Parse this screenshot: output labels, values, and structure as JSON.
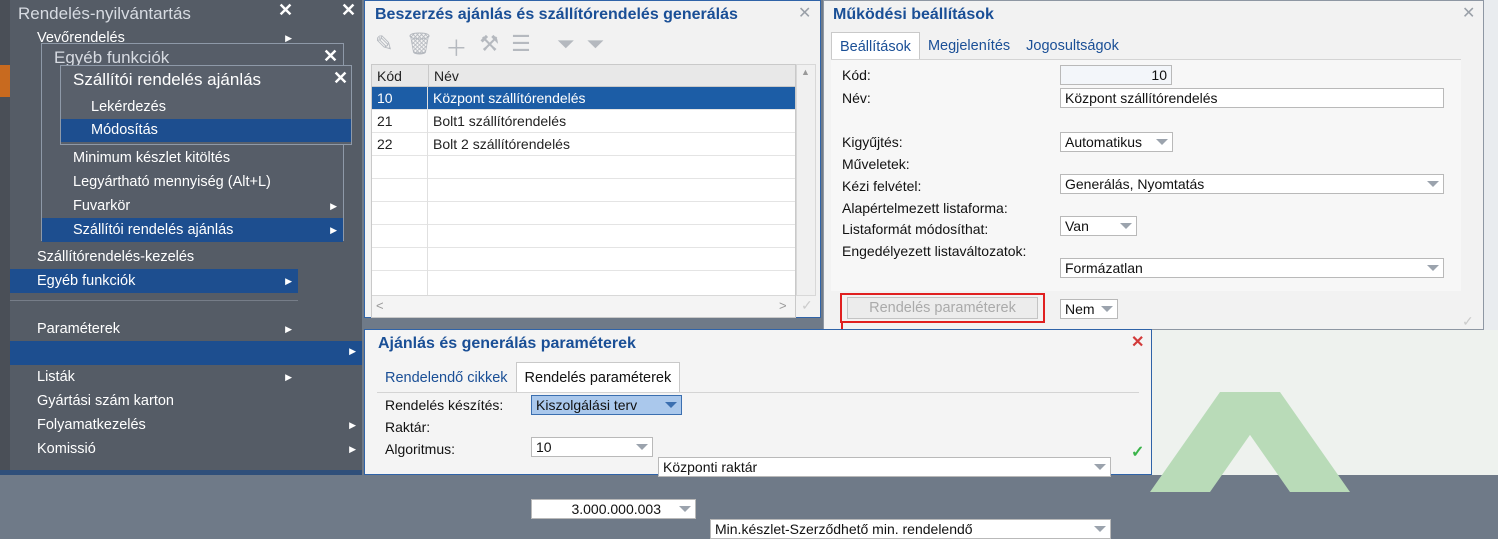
{
  "main_menu": {
    "title": "Rendelés-nyilvántartás",
    "items": [
      {
        "label": "Vevőrendelés"
      },
      {
        "label": "Szállítórendelés-kezelés"
      },
      {
        "label": "Egyéb funkciók"
      },
      {
        "label": "Paraméterek"
      },
      {
        "label": "Listák"
      },
      {
        "label": "Gyártási szám karton"
      },
      {
        "label": "Folyamatkezelés"
      },
      {
        "label": "Komissió"
      }
    ]
  },
  "submenu1": {
    "title": "Egyéb funkciók",
    "items": [
      {
        "label": "Minimum készlet kitöltés"
      },
      {
        "label": "Legyártható mennyiség (Alt+L)"
      },
      {
        "label": "Fuvarkör"
      },
      {
        "label": "Szállítói rendelés ajánlás"
      }
    ]
  },
  "submenu2": {
    "title": "Szállítói rendelés ajánlás",
    "items": [
      {
        "label": "Lekérdezés"
      },
      {
        "label": "Módosítás"
      }
    ]
  },
  "list_window": {
    "title": "Beszerzés ajánlás és szállítórendelés generálás",
    "columns": [
      "Kód",
      "Név"
    ],
    "rows": [
      {
        "code": "10",
        "name": "Központ szállítórendelés"
      },
      {
        "code": "21",
        "name": "Bolt1 szállítórendelés"
      },
      {
        "code": "22",
        "name": "Bolt 2 szállítórendelés"
      }
    ]
  },
  "settings_window": {
    "title": "Működési beállítások",
    "tabs": [
      "Beállítások",
      "Megjelenítés",
      "Jogosultságok"
    ],
    "fields": {
      "kod_label": "Kód:",
      "kod_value": "10",
      "nev_label": "Név:",
      "nev_value": "Központ szállítórendelés",
      "kigyujtes_label": "Kigyűjtés:",
      "kigyujtes_value": "Automatikus",
      "muveletek_label": "Műveletek:",
      "muveletek_value": "Generálás, Nyomtatás",
      "kezi_label": "Kézi felvétel:",
      "kezi_value": "Van",
      "listaforma_label": "Alapértelmezett listaforma:",
      "listaforma_value": "Formázatlan",
      "modosithat_label": "Listaformát módosíthat:",
      "modosithat_value": "Nem",
      "engedelyezett_label": "Engedélyezett listaváltozatok:",
      "engedelyezett_value": ""
    },
    "params_button": "Rendelés paraméterek"
  },
  "params_window": {
    "title": "Ajánlás és generálás paraméterek",
    "tabs": [
      "Rendelendő cikkek",
      "Rendelés paraméterek"
    ],
    "fields": {
      "keszites_label": "Rendelés készítés:",
      "keszites_value": "Kiszolgálási terv",
      "raktar_label": "Raktár:",
      "raktar_code": "10",
      "raktar_name": "Központi raktár",
      "algoritmus_label": "Algoritmus:",
      "algoritmus_code": "3.000.000.003",
      "algoritmus_name": "Min.készlet-Szerződhető min. rendelendő"
    }
  },
  "colors": {
    "accent": "#1a4f96",
    "selection": "#1c5da6",
    "highlight_box": "#e02020"
  }
}
